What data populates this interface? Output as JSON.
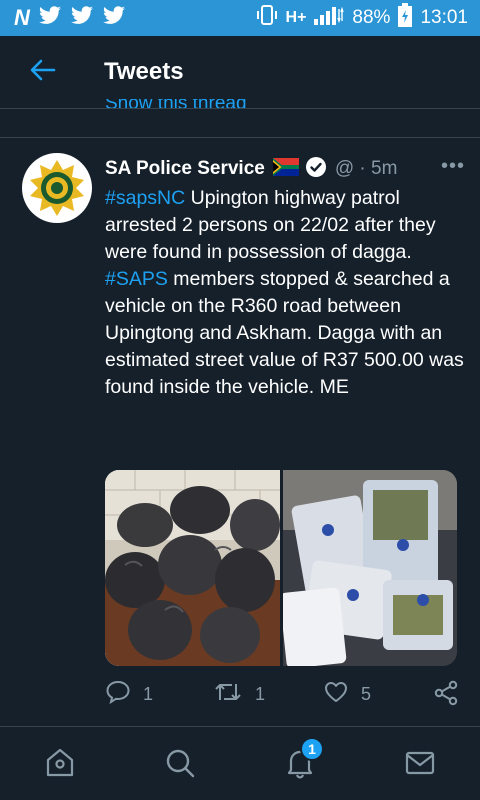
{
  "status_bar": {
    "signal_type": "H+",
    "battery": "88%",
    "time": "13:01",
    "icons": [
      "n-app-icon",
      "twitter-icon",
      "twitter-icon",
      "twitter-icon",
      "vibrate-icon",
      "signal-icon",
      "battery-icon"
    ]
  },
  "header": {
    "title": "Tweets",
    "back_icon": "back-arrow-icon"
  },
  "thread": {
    "show_thread_label": "Show this thread"
  },
  "tweet": {
    "author_name": "SA Police Service",
    "handle": "@",
    "time": "· 5m",
    "more_label": "•••",
    "text": {
      "p1_tag": "#sapsNC",
      "p1_text": " Upington highway patrol arrested 2 persons on 22/02 after they were found in possession of dagga.",
      "p2_tag": "#SAPS",
      "p2_text": " members stopped & searched a vehicle on the R360 road between Upingtong and Askham.  Dagga with an estimated street value of R37 500.00 was found inside the vehicle. ME"
    },
    "actions": {
      "reply_count": "1",
      "retweet_count": "1",
      "like_count": "5"
    }
  },
  "bottom_nav": {
    "items": [
      "home-icon",
      "search-icon",
      "notifications-icon",
      "messages-icon"
    ],
    "notifications_badge": "1"
  },
  "colors": {
    "background": "#15202b",
    "status_bar": "#2b95d6",
    "accent": "#1da1f2",
    "secondary_text": "#8899a6",
    "divider": "#38444d"
  }
}
